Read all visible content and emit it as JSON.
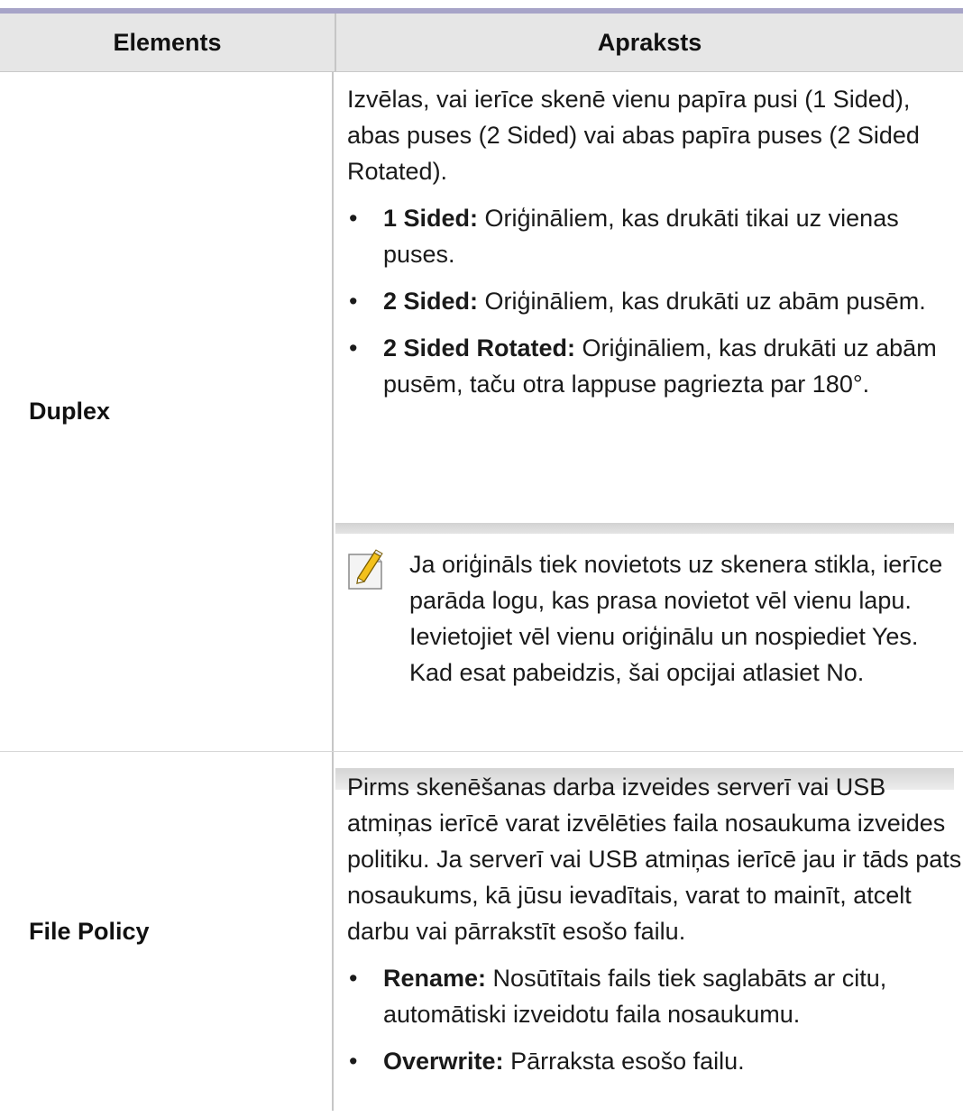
{
  "table": {
    "header": {
      "col1": "Elements",
      "col2": "Apraksts"
    },
    "rows": [
      {
        "element": "Duplex",
        "intro": "Izvēlas, vai ierīce skenē vienu papīra pusi (1 Sided), abas puses (2 Sided) vai abas papīra puses (2 Sided Rotated).",
        "bullets": [
          {
            "term": "1 Sided:",
            "text": " Oriģināliem, kas drukāti tikai uz vienas puses."
          },
          {
            "term": "2 Sided:",
            "text": " Oriģināliem, kas drukāti uz abām pusēm."
          },
          {
            "term": "2 Sided Rotated:",
            "text": " Oriģināliem, kas drukāti uz abām pusēm, taču otra lappuse pagriezta par 180°."
          }
        ],
        "note": {
          "icon": "note-pencil-icon",
          "text": "Ja oriģināls tiek novietots uz skenera stikla, ierīce parāda logu, kas prasa novietot vēl vienu lapu. Ievietojiet vēl vienu oriģinālu un nospiediet Yes. Kad esat pabeidzis, šai opcijai atlasiet No."
        }
      },
      {
        "element": "File Policy",
        "intro": "Pirms skenēšanas darba izveides serverī vai USB atmiņas ierīcē varat izvēlēties faila nosaukuma izveides politiku. Ja serverī vai USB atmiņas ierīcē jau ir tāds pats nosaukums, kā jūsu ievadītais, varat to mainīt, atcelt darbu vai pārrakstīt esošo failu.",
        "bullets": [
          {
            "term": "Rename:",
            "text": " Nosūtītais fails tiek saglabāts ar citu, automātiski izveidotu faila nosaukumu."
          },
          {
            "term": "Overwrite:",
            "text": " Pārraksta esošo failu."
          }
        ]
      }
    ]
  },
  "colors": {
    "header_bg": "#e6e6e6",
    "top_rule": "#a7a4c8",
    "note_bar": "#d4d4d4"
  }
}
